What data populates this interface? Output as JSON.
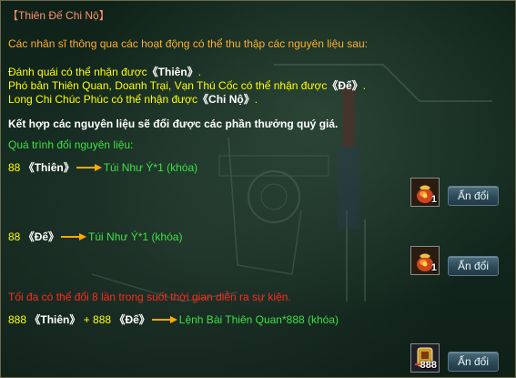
{
  "title": "【Thiên Đế Chi Nộ】",
  "intro": "Các nhân sĩ thông qua các hoạt động có thể thu thập các nguyên liệu sau:",
  "sources": [
    {
      "prefix": "Đánh quái có thể nhận được",
      "item": "《Thiên》",
      "suffix": "."
    },
    {
      "prefix": "Phó bản Thiên Quan, Doanh Trại, Vạn Thú Cốc có thể nhận được",
      "item": "《Đế》",
      "suffix": "."
    },
    {
      "prefix": "Long Chi Chúc Phúc có thể nhận được",
      "item": "《Chi Nộ》",
      "suffix": "."
    }
  ],
  "combine": "Kết hợp các nguyên liệu sẽ đổi được các phần thưởng quý giá.",
  "process_label": "Quá trình đổi nguyên liệu:",
  "exchanges": [
    {
      "cost_num": "88",
      "cost_item": "《Thiên》",
      "cost_extra_num": "",
      "cost_extra_item": "",
      "reward": "Túi Như Ý*1 (khóa)",
      "qty": "1",
      "icon": "lucky-bag-icon"
    },
    {
      "cost_num": "88",
      "cost_item": "《Đế》",
      "cost_extra_num": "",
      "cost_extra_item": "",
      "reward": "Túi Như Ý*1 (khóa)",
      "qty": "1",
      "icon": "lucky-bag-icon"
    },
    {
      "cost_num": "888",
      "cost_item": "《Thiên》",
      "cost_extra_num": "+ 888",
      "cost_extra_item": "《Đế》",
      "reward": "Lệnh Bài Thiên Quan*888 (khóa)",
      "qty": "888",
      "icon": "token-icon"
    }
  ],
  "limit_note": "Tối đa có thể đổi 8 lần trong suốt thời gian diễn ra sự kiện.",
  "exchange_button_label": "Ấn đổi",
  "colors": {
    "title": "#ff8f6a",
    "intro": "#ffaf2e",
    "source_text": "#ffff00",
    "highlight": "#ffffff",
    "green": "#3ee046",
    "arrow": "#ffaa00",
    "warning": "#ff2a1f"
  }
}
